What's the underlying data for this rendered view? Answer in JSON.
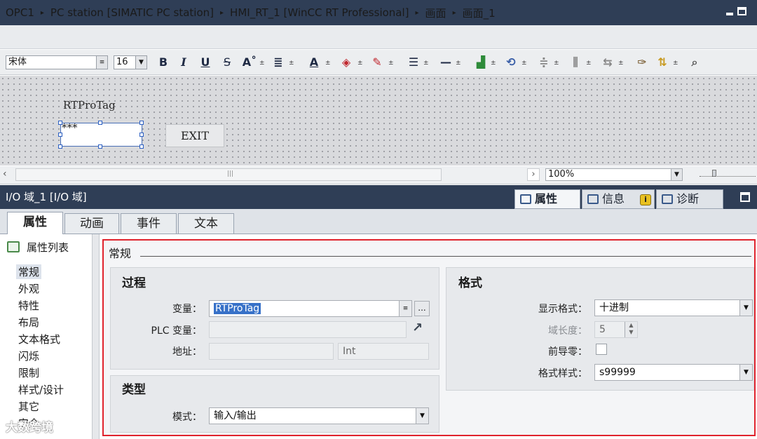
{
  "titlebar": {
    "crumbs": [
      "OPC1",
      "PC station [SIMATIC PC station]",
      "HMI_RT_1 [WinCC RT Professional]",
      "画面",
      "画面_1"
    ],
    "separator": "▸"
  },
  "toolbar": {
    "font_name": "宋体",
    "font_size": "16",
    "bold": "B",
    "italic": "I",
    "underline": "U",
    "strike": "S",
    "font_grow": "A˚"
  },
  "canvas": {
    "label_text": "RTProTag",
    "io_value": "***",
    "exit_label": "EXIT"
  },
  "viewbar": {
    "zoom": "100%"
  },
  "inspector": {
    "title": "I/O 域_1 [I/O 域]",
    "tab_properties": "属性",
    "tab_info": "信息",
    "info_badge": "i",
    "tab_diagnostics": "诊断"
  },
  "prop_tabs": [
    "属性",
    "动画",
    "事件",
    "文本"
  ],
  "left_list": {
    "heading": "属性列表",
    "items": [
      "常规",
      "外观",
      "特性",
      "布局",
      "文本格式",
      "闪烁",
      "限制",
      "样式/设计",
      "其它",
      "安全"
    ]
  },
  "general": {
    "section_title": "常规",
    "process": {
      "title": "过程",
      "variable_label": "变量：",
      "variable_value": "RTProTag",
      "plc_variable_label": "PLC 变量：",
      "plc_variable_value": "",
      "address_label": "地址：",
      "address_value": "",
      "address_type": "Int",
      "browse_button": "..."
    },
    "type": {
      "title": "类型",
      "mode_label": "模式：",
      "mode_value": "输入/输出"
    },
    "format": {
      "title": "格式",
      "display_format_label": "显示格式：",
      "display_format_value": "十进制",
      "field_length_label": "域长度：",
      "field_length_value": "5",
      "leading_zeros_label": "前导零：",
      "leading_zeros_checked": false,
      "format_pattern_label": "格式样式：",
      "format_pattern_value": "s99999"
    }
  },
  "watermark": "大数跨境"
}
